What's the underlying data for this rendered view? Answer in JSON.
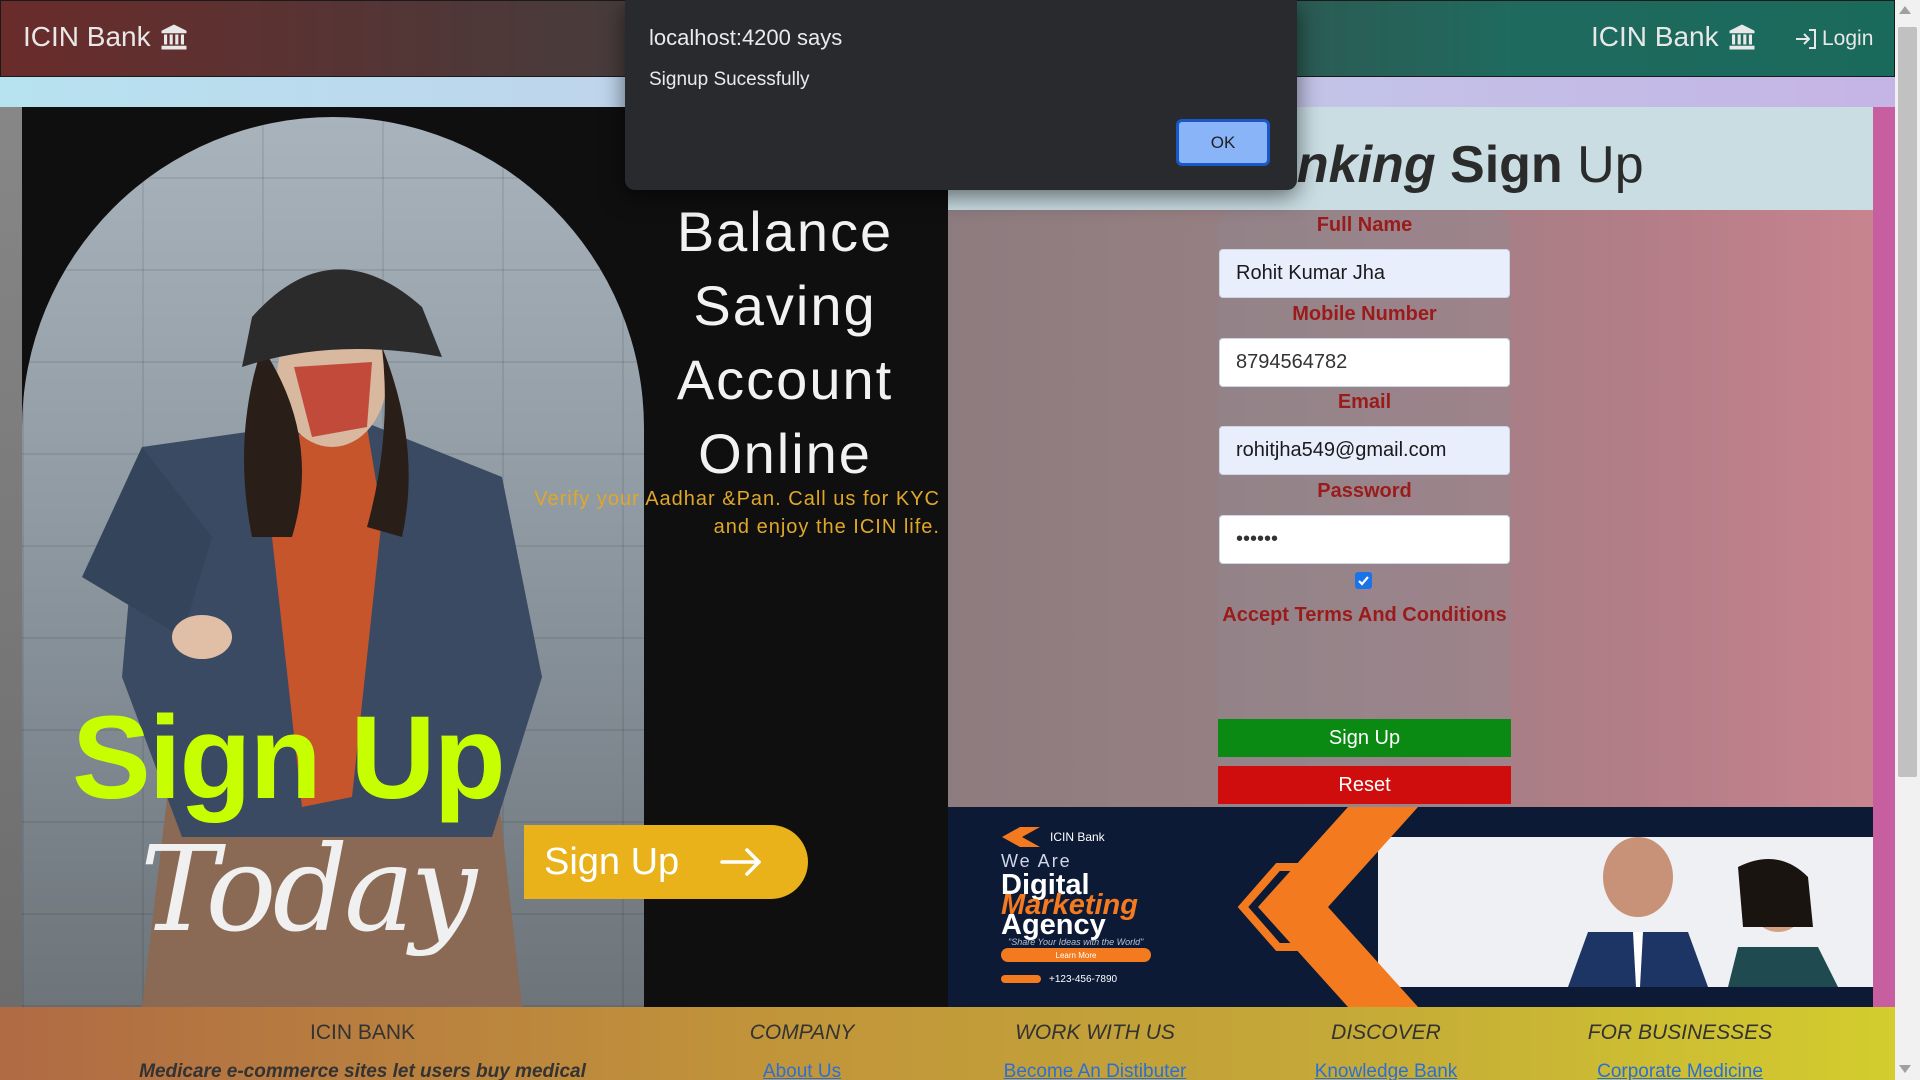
{
  "navbar": {
    "brand_left": "ICIN Bank",
    "brand_right": "ICIN Bank",
    "login_label": "Login"
  },
  "poster": {
    "title_lines": [
      "Balance",
      "Saving",
      "Account",
      "Online"
    ],
    "subtitle": "Verify your Aadhar &Pan. Call us for KYC and enjoy the ICIN life.",
    "headline": "Sign Up",
    "script_word": "Today",
    "button_label": "Sign Up",
    "accent_color": "#c8ff00",
    "button_color": "#e9b11a"
  },
  "signup": {
    "title_italic": "anking",
    "title_bold": "Sign",
    "title_rest": "Up",
    "fields": {
      "full_name": {
        "label": "Full Name",
        "value": "Rohit Kumar Jha"
      },
      "mobile": {
        "label": "Mobile Number",
        "value": "8794564782"
      },
      "email": {
        "label": "Email",
        "value": "rohitjha549@gmail.com"
      },
      "password": {
        "label": "Password",
        "value": "••••••"
      }
    },
    "terms_checked": true,
    "terms_label": "Accept Terms And Conditions",
    "signup_button": "Sign Up",
    "reset_button": "Reset",
    "label_color": "#9b1b1b"
  },
  "ad": {
    "logo_text": "ICIN Bank",
    "we_are": "We Are",
    "line1": "Digital",
    "line2": "Marketing",
    "line3": "Agency",
    "tagline": "\"Share Your Ideas with the World\"",
    "cta": "Learn More",
    "phone": "+123-456-7890"
  },
  "footer": {
    "columns": [
      {
        "heading": "ICIN BANK",
        "text": "Medicare e-commerce sites let users buy medical"
      },
      {
        "heading": "COMPANY",
        "link": "About Us"
      },
      {
        "heading": "WORK WITH US",
        "link": "Become An Distibuter"
      },
      {
        "heading": "DISCOVER",
        "link": "Knowledge Bank"
      },
      {
        "heading": "FOR BUSINESSES",
        "link": "Corporate Medicine"
      }
    ]
  },
  "dialog": {
    "title": "localhost:4200 says",
    "message": "Signup Sucessfully",
    "ok_label": "OK"
  }
}
